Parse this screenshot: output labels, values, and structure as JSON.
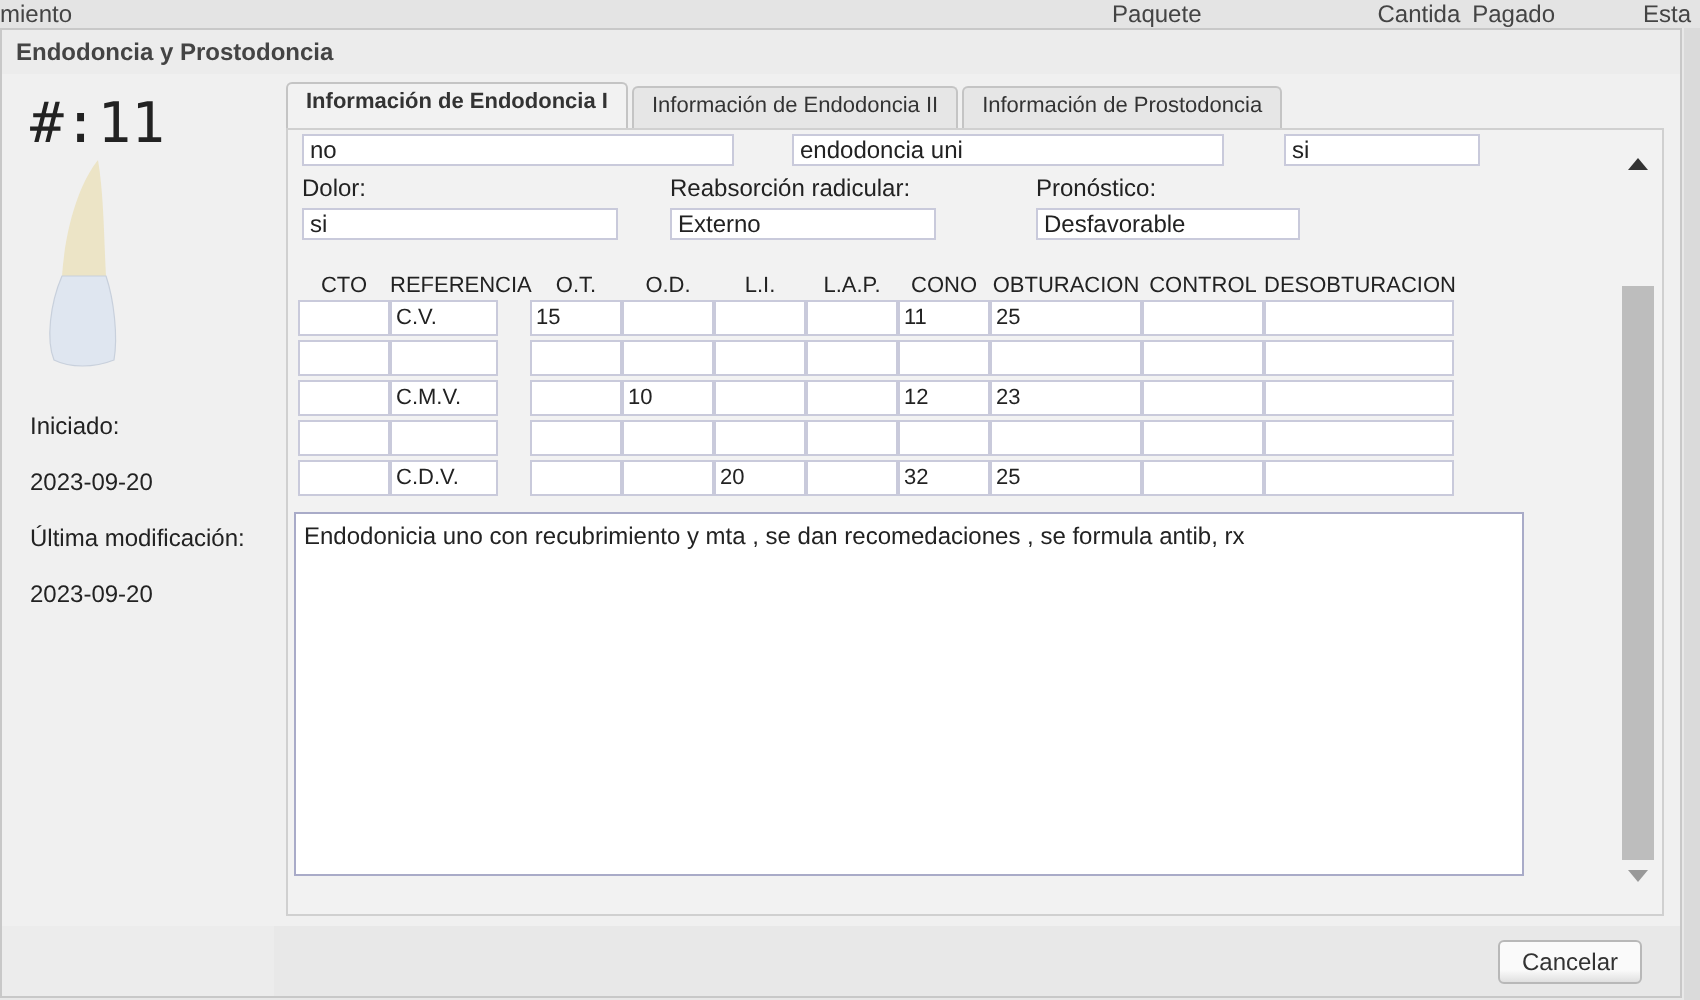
{
  "background_header": {
    "columns": [
      "miento",
      "Paquete",
      "Cantida",
      "Pagado",
      "Esta"
    ]
  },
  "dialog": {
    "title": "Endodoncia y Prostodoncia"
  },
  "tooth": {
    "label": "#:11"
  },
  "dates": [
    {
      "label": "Iniciado:",
      "value": "2023-09-20"
    },
    {
      "label": "Última modificación:",
      "value": "2023-09-20"
    }
  ],
  "tabs": [
    {
      "label": "Información de Endodoncia I",
      "selected": true
    },
    {
      "label": "Información de Endodoncia II",
      "selected": false
    },
    {
      "label": "Información de Prostodoncia",
      "selected": false
    }
  ],
  "partial_fields": [
    "no",
    "endodoncia uni",
    "si"
  ],
  "fields": [
    {
      "label": "Dolor:",
      "value": "si"
    },
    {
      "label": "Reabsorción radicular:",
      "value": "Externo"
    },
    {
      "label": "Pronóstico:",
      "value": "Desfavorable"
    }
  ],
  "table": {
    "columns": [
      "CTO",
      "REFERENCIA",
      "O.T.",
      "O.D.",
      "L.I.",
      "L.A.P.",
      "CONO",
      "OBTURACION",
      "CONTROL",
      "DESOBTURACION"
    ],
    "rows": [
      [
        null,
        "C.V.",
        "15",
        null,
        null,
        null,
        "11",
        "25",
        null,
        null
      ],
      [
        null,
        null,
        null,
        null,
        null,
        null,
        null,
        null,
        null,
        null
      ],
      [
        null,
        "C.M.V.",
        null,
        "10",
        null,
        null,
        "12",
        "23",
        null,
        null
      ],
      [
        null,
        null,
        null,
        null,
        null,
        null,
        null,
        null,
        null,
        null
      ],
      [
        null,
        "C.D.V.",
        null,
        null,
        "20",
        null,
        "32",
        "25",
        null,
        null
      ]
    ]
  },
  "notes": {
    "value": "Endodonicia uno con recubrimiento y mta , se dan recomedaciones , se formula antib, rx"
  },
  "buttons": [
    "Cancelar"
  ]
}
